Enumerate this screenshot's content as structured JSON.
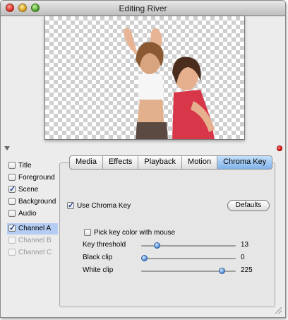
{
  "window": {
    "title": "Editing River"
  },
  "sidebar": {
    "items": [
      {
        "label": "Title",
        "checked": false,
        "enabled": true,
        "selected": false
      },
      {
        "label": "Foreground",
        "checked": false,
        "enabled": true,
        "selected": false
      },
      {
        "label": "Scene",
        "checked": true,
        "enabled": true,
        "selected": false
      },
      {
        "label": "Background",
        "checked": false,
        "enabled": true,
        "selected": false
      },
      {
        "label": "Audio",
        "checked": false,
        "enabled": true,
        "selected": false
      },
      {
        "label": "Channel A",
        "checked": true,
        "enabled": true,
        "selected": true
      },
      {
        "label": "Channel B",
        "checked": false,
        "enabled": false,
        "selected": false
      },
      {
        "label": "Channel C",
        "checked": false,
        "enabled": false,
        "selected": false
      }
    ]
  },
  "tabs": [
    {
      "label": "Media",
      "active": false
    },
    {
      "label": "Effects",
      "active": false
    },
    {
      "label": "Playback",
      "active": false
    },
    {
      "label": "Motion",
      "active": false
    },
    {
      "label": "Chroma Key",
      "active": true
    }
  ],
  "chroma": {
    "use_label": "Use Chroma Key",
    "use_checked": true,
    "defaults_label": "Defaults",
    "pick_label": "Pick key color with mouse",
    "pick_checked": false,
    "sliders": [
      {
        "label": "Key threshold",
        "value": "13",
        "fraction": 0.14
      },
      {
        "label": "Black clip",
        "value": "0",
        "fraction": 0.0
      },
      {
        "label": "White clip",
        "value": "225",
        "fraction": 0.88
      }
    ]
  },
  "colors": {
    "accent": "#7fb3ea",
    "selection": "#b5cdf3"
  }
}
